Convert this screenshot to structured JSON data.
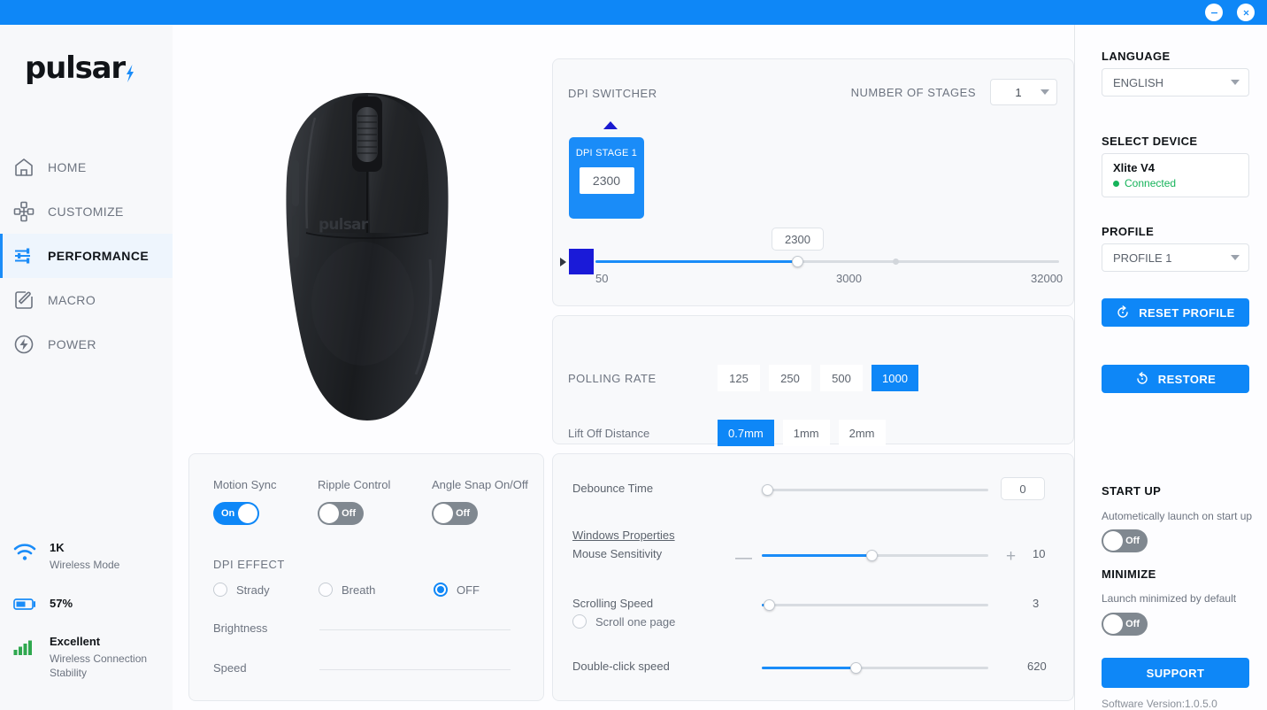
{
  "titlebar": {
    "minimize_label": "minimize",
    "close_label": "close"
  },
  "sidebar": {
    "logo_text": "pulsar",
    "items": [
      {
        "label": "HOME",
        "icon": "home-icon"
      },
      {
        "label": "CUSTOMIZE",
        "icon": "dpad-icon"
      },
      {
        "label": "PERFORMANCE",
        "icon": "sliders-icon"
      },
      {
        "label": "MACRO",
        "icon": "edit-icon"
      },
      {
        "label": "POWER",
        "icon": "power-icon"
      }
    ],
    "status": {
      "wireless_value": "1K",
      "wireless_label": "Wireless Mode",
      "battery_value": "57%",
      "stability_value": "Excellent",
      "stability_label": "Wireless Connection Stability"
    }
  },
  "dpi": {
    "title": "DPI SWITCHER",
    "stages_label": "NUMBER OF STAGES",
    "stages_value": "1",
    "stage_card_title": "DPI STAGE 1",
    "stage_card_value": "2300",
    "slider_bubble": "2300",
    "tick_min": "50",
    "tick_mid": "3000",
    "tick_max": "32000",
    "swatch_color": "#1a1ad8"
  },
  "polling": {
    "label": "POLLING RATE",
    "options": [
      "125",
      "250",
      "500",
      "1000"
    ],
    "selected": "1000",
    "lod_label": "Lift Off Distance",
    "lod_options": [
      "0.7mm",
      "1mm",
      "2mm"
    ],
    "lod_selected": "0.7mm"
  },
  "effects": {
    "toggles": [
      {
        "label": "Motion Sync",
        "state": "On"
      },
      {
        "label": "Ripple Control",
        "state": "Off"
      },
      {
        "label": "Angle Snap On/Off",
        "state": "Off"
      }
    ],
    "dpi_effect_label": "DPI EFFECT",
    "radios": [
      {
        "label": "Strady",
        "checked": false
      },
      {
        "label": "Breath",
        "checked": false
      },
      {
        "label": "OFF",
        "checked": true
      }
    ],
    "brightness_label": "Brightness",
    "speed_label": "Speed"
  },
  "sliders": {
    "debounce_label": "Debounce Time",
    "debounce_value": "0",
    "windows_properties": "Windows Properties",
    "sensitivity_label": "Mouse Sensitivity",
    "sensitivity_value": "10",
    "minus": "—",
    "plus": "+",
    "scrolling_label": "Scrolling Speed",
    "scrolling_value": "3",
    "scroll_one_page": "Scroll one page",
    "dblclick_label": "Double-click speed",
    "dblclick_value": "620"
  },
  "right": {
    "language_head": "LANGUAGE",
    "language_value": "ENGLISH",
    "device_head": "SELECT DEVICE",
    "device_name": "Xlite V4",
    "device_status": "Connected",
    "profile_head": "PROFILE",
    "profile_value": "PROFILE 1",
    "reset_profile": "RESET PROFILE",
    "restore": "RESTORE",
    "startup_head": "START UP",
    "startup_sub": "Autometically launch on start up",
    "startup_state": "Off",
    "minimize_head": "MINIMIZE",
    "minimize_sub": "Launch minimized by default",
    "minimize_state": "Off",
    "support": "SUPPORT",
    "version": "Software Version:1.0.5.0"
  },
  "colors": {
    "accent": "#0e87f7",
    "accent_dark": "#1a1ad8",
    "green": "#16b35a"
  }
}
